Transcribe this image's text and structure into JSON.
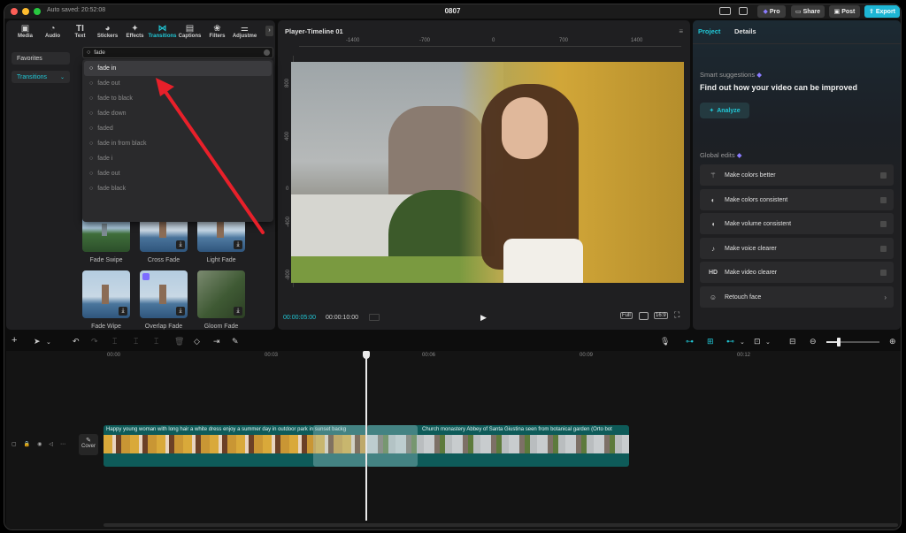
{
  "titlebar": {
    "autosave": "Auto saved: 20:52:08",
    "title": "0807",
    "pro_label": "Pro",
    "share_label": "Share",
    "post_label": "Post",
    "export_label": "Export"
  },
  "toolbar": {
    "items": [
      {
        "label": "Media",
        "icon": "media-icon"
      },
      {
        "label": "Audio",
        "icon": "audio-icon"
      },
      {
        "label": "Text",
        "icon": "text-icon"
      },
      {
        "label": "Stickers",
        "icon": "stickers-icon"
      },
      {
        "label": "Effects",
        "icon": "effects-icon"
      },
      {
        "label": "Transitions",
        "icon": "transitions-icon"
      },
      {
        "label": "Captions",
        "icon": "captions-icon"
      },
      {
        "label": "Filters",
        "icon": "filters-icon"
      },
      {
        "label": "Adjustme",
        "icon": "adjustment-icon"
      }
    ]
  },
  "sidebar": {
    "favorites_label": "Favorites",
    "transitions_label": "Transitions"
  },
  "search": {
    "value": "fade",
    "suggestions": [
      "fade in",
      "fade out",
      "fade to black",
      "fade down",
      "faded",
      "fade in from black",
      "fade i",
      "fade  out",
      "fade black"
    ]
  },
  "transitions_grid": [
    {
      "label": "Fade Swipe"
    },
    {
      "label": "Cross Fade"
    },
    {
      "label": "Light Fade"
    },
    {
      "label": "Fade Wipe"
    },
    {
      "label": "Overlap Fade"
    },
    {
      "label": "Gloom Fade"
    }
  ],
  "player": {
    "title": "Player-Timeline 01",
    "ruler_h": [
      "-1400",
      "-700",
      "0",
      "700",
      "1400"
    ],
    "ruler_v": [
      "800",
      "400",
      "0",
      "-400",
      "-800"
    ],
    "current_time": "00:00:05:00",
    "total_time": "00:00:10:00",
    "full_label": "Full",
    "ratio_label": "16:9"
  },
  "right_panel": {
    "tab_project": "Project",
    "tab_details": "Details",
    "smart_title": "Smart suggestions",
    "smart_heading": "Find out how your video can be improved",
    "analyze_label": "Analyze",
    "global_title": "Global edits",
    "global_items": [
      {
        "label": "Make colors better",
        "icon": "magic-wand-icon"
      },
      {
        "label": "Make colors consistent",
        "icon": "color-match-icon"
      },
      {
        "label": "Make volume consistent",
        "icon": "volume-icon"
      },
      {
        "label": "Make voice clearer",
        "icon": "voice-icon"
      },
      {
        "label": "Make video clearer",
        "icon": "hd-icon"
      },
      {
        "label": "Retouch face",
        "icon": "retouch-icon"
      }
    ],
    "hd_text": "HD"
  },
  "timeline": {
    "ticks": [
      "00:00",
      "00:03",
      "00:06",
      "00:09",
      "00:12"
    ],
    "cover_label": "Cover",
    "clip1_text": "Happy young woman with long hair a white dress enjoy a summer day in outdoor park in sunset backg",
    "clip2_text": "Church monastery Abbey of Santa Giustina seen from botanical garden (Orto bot"
  },
  "colors": {
    "accent": "#21c8d7",
    "arrow": "#e8202a",
    "clip_bg": "#0e5b59"
  }
}
